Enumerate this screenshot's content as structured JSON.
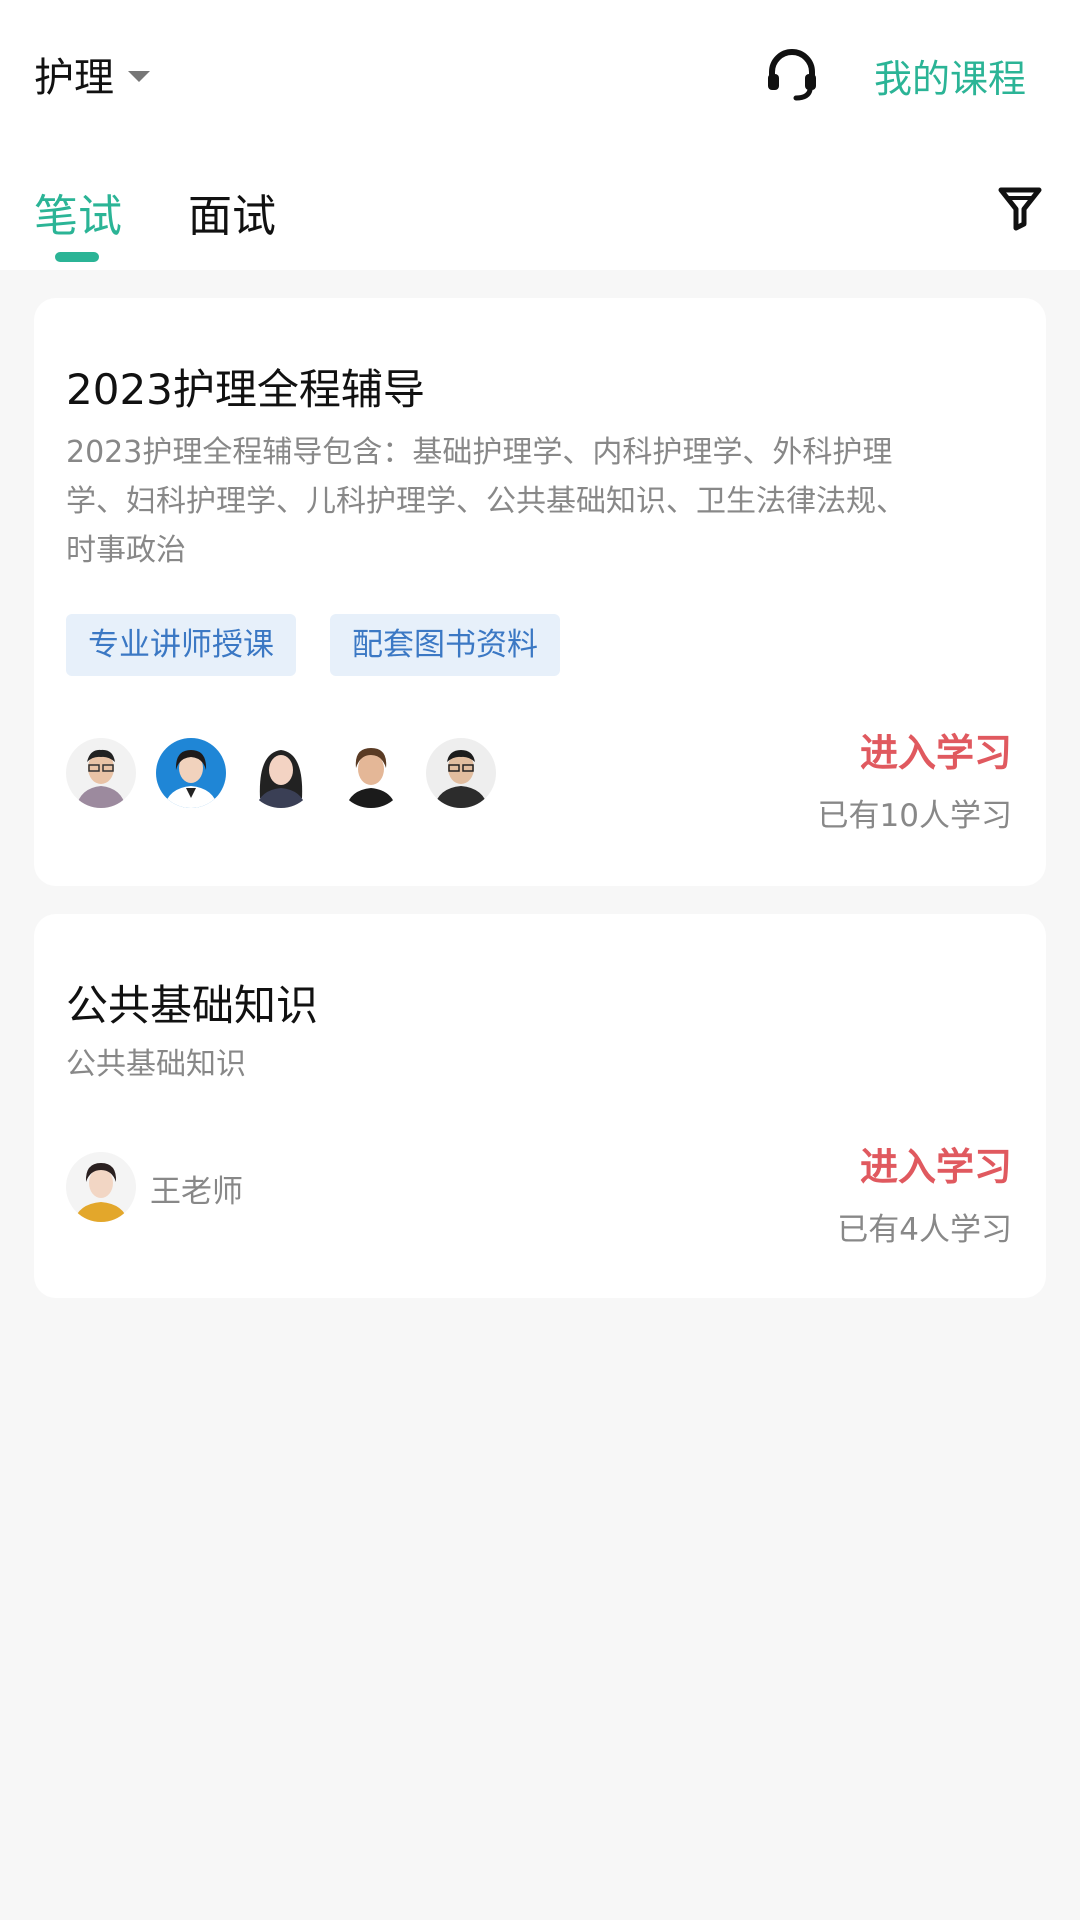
{
  "header": {
    "category": "护理",
    "my_course": "我的课程"
  },
  "tabs": [
    {
      "label": "笔试",
      "active": true
    },
    {
      "label": "面试",
      "active": false
    }
  ],
  "colors": {
    "accent": "#2bb496",
    "enter": "#e0595f",
    "tag_bg": "#e7f0fa",
    "tag_text": "#3b78c4"
  },
  "courses": [
    {
      "title": "2023护理全程辅导",
      "description_lines": [
        "2023护理全程辅导包含：基础护理学、内科护理学、外科护理",
        "学、妇科护理学、儿科护理学、公共基础知识、卫生法律法规、",
        "时事政治"
      ],
      "tags": [
        "专业讲师授课",
        "配套图书资料"
      ],
      "enter_label": "进入学习",
      "learner_count": "已有10人学习"
    },
    {
      "title": "公共基础知识",
      "description_lines": [
        "公共基础知识"
      ],
      "teacher": "王老师",
      "enter_label": "进入学习",
      "learner_count": "已有4人学习"
    }
  ]
}
